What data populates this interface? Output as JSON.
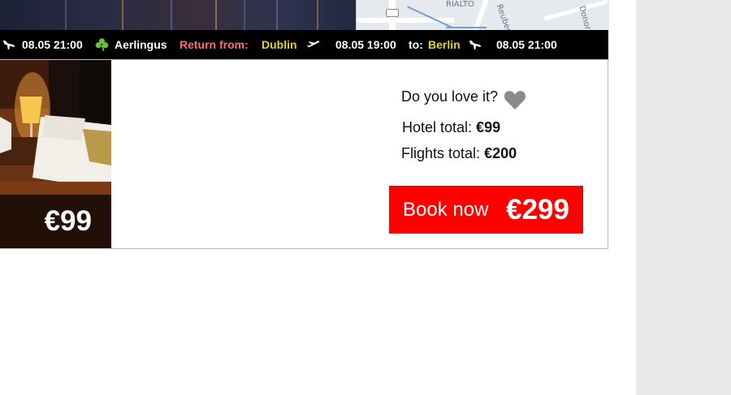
{
  "map": {
    "labels": [
      "RIALTO",
      "Reuben St",
      "Donore"
    ]
  },
  "flight_strip": {
    "outbound_arrival": "08.05 21:00",
    "airline": "Aerlingus",
    "return_label": "Return",
    "from_label": "from:",
    "from_city": "Dublin",
    "return_departure": "08.05 19:00",
    "to_label": "to:",
    "to_city": "Berlin",
    "return_arrival": "08.05 21:00"
  },
  "hotel_card": {
    "hotel_price": "€99",
    "love_prompt": "Do you love it?",
    "hotel_total_label": "Hotel total:",
    "hotel_total_value": "€99",
    "flights_total_label": "Flights total:",
    "flights_total_value": "€200",
    "book_label": "Book now",
    "book_total": "€299"
  },
  "colors": {
    "book_button": "#ff0000",
    "strip_background": "#000000",
    "strip_city": "#e8d21c",
    "strip_return": "#ff6b6b",
    "airline_shamrock": "#6fbf3a",
    "heart": "#8a8a8a",
    "sidebar": "#e9e9e9"
  },
  "icons": {
    "plane_landing": "plane-landing-icon",
    "plane_takeoff": "plane-takeoff-icon",
    "shamrock": "shamrock-icon",
    "heart": "heart-icon"
  }
}
